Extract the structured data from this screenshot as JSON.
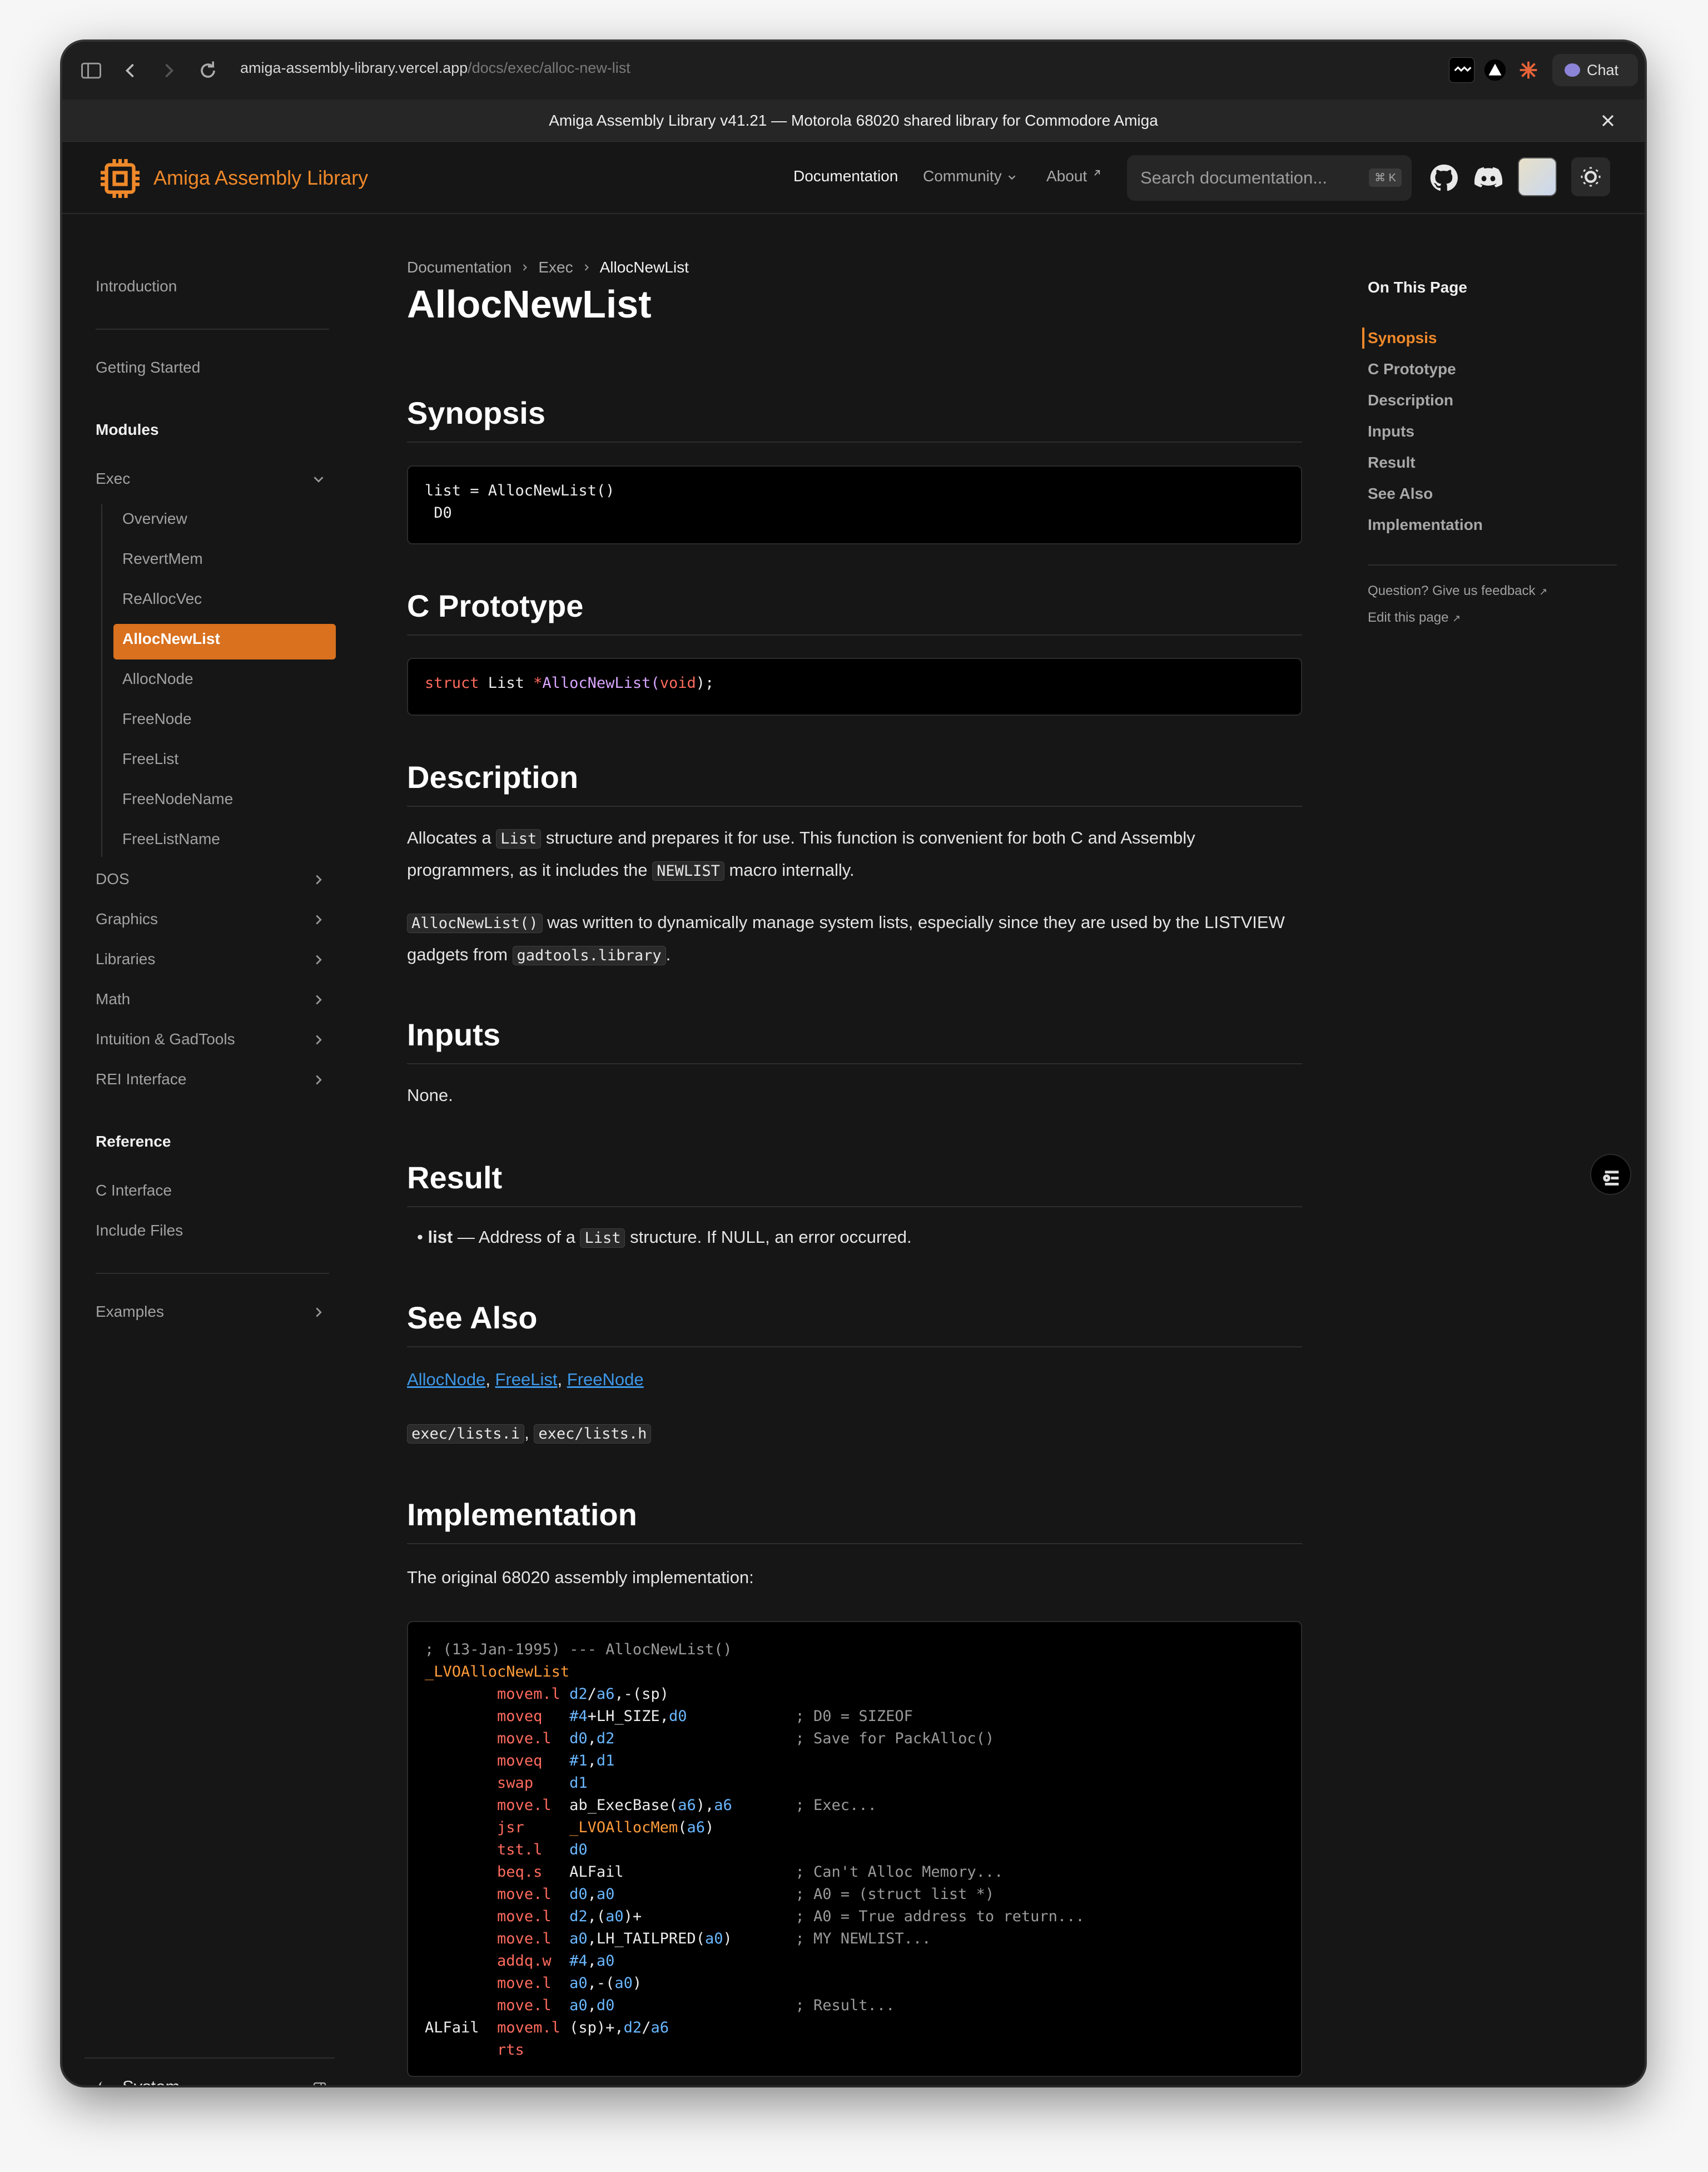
{
  "browser": {
    "url_host": "amiga-assembly-library.vercel.app",
    "url_path": "/docs/exec/alloc-new-list",
    "chat_label": "Chat"
  },
  "banner": {
    "text": "Amiga Assembly Library v41.21 — Motorola 68020 shared library for Commodore Amiga"
  },
  "header": {
    "brand": "Amiga Assembly Library",
    "nav_documentation": "Documentation",
    "nav_community": "Community",
    "nav_about": "About",
    "search_placeholder": "Search documentation...",
    "search_shortcut": "⌘ K"
  },
  "sidebar": {
    "introduction": "Introduction",
    "getting_started": "Getting Started",
    "modules_heading": "Modules",
    "exec": "Exec",
    "exec_items": [
      "Overview",
      "RevertMem",
      "ReAllocVec",
      "AllocNewList",
      "AllocNode",
      "FreeNode",
      "FreeList",
      "FreeNodeName",
      "FreeListName"
    ],
    "modules": [
      "DOS",
      "Graphics",
      "Libraries",
      "Math",
      "Intuition & GadTools",
      "REI Interface"
    ],
    "reference_heading": "Reference",
    "reference_items": [
      "C Interface",
      "Include Files"
    ],
    "examples": "Examples",
    "system_label": "System"
  },
  "breadcrumb": {
    "root": "Documentation",
    "section": "Exec",
    "current": "AllocNewList"
  },
  "page": {
    "title": "AllocNewList",
    "synopsis_heading": "Synopsis",
    "synopsis_code_line1": "list = AllocNewList()",
    "synopsis_code_line2": " D0",
    "prototype_heading": "C Prototype",
    "prototype": {
      "kw": "struct",
      "type": " List ",
      "star": "*",
      "fn": "AllocNewList",
      "paren_open": "(",
      "arg": "void",
      "paren_close": ");"
    },
    "description_heading": "Description",
    "desc1_a": "Allocates a ",
    "desc1_code1": "List",
    "desc1_b": " structure and prepares it for use. This function is convenient for both C and Assembly programmers, as it includes the ",
    "desc1_code2": "NEWLIST",
    "desc1_c": " macro internally.",
    "desc2_code1": "AllocNewList()",
    "desc2_a": " was written to dynamically manage system lists, especially since they are used by the LISTVIEW gadgets from ",
    "desc2_code2": "gadtools.library",
    "desc2_b": ".",
    "inputs_heading": "Inputs",
    "inputs_text": "None.",
    "result_heading": "Result",
    "result_term": "list",
    "result_a": " — Address of a ",
    "result_code": "List",
    "result_b": " structure. If NULL, an error occurred.",
    "seealso_heading": "See Also",
    "seealso_links": [
      "AllocNode",
      "FreeList",
      "FreeNode"
    ],
    "seealso_files": [
      "exec/lists.i",
      "exec/lists.h"
    ],
    "impl_heading": "Implementation",
    "impl_text": "The original 68020 assembly implementation:",
    "asm": [
      {
        "label": "",
        "op": "",
        "args": "",
        "comment": "; (13-Jan-1995) --- AllocNewList()"
      },
      {
        "label": "_LVOAllocNewList",
        "op": "",
        "args": "",
        "comment": ""
      },
      {
        "label": "",
        "op": "movem.l",
        "args": "d2/a6,-(sp)",
        "comment": ""
      },
      {
        "label": "",
        "op": "moveq",
        "args": "#4+LH_SIZE,d0",
        "comment": "; D0 = SIZEOF"
      },
      {
        "label": "",
        "op": "move.l",
        "args": "d0,d2",
        "comment": "; Save for PackAlloc()"
      },
      {
        "label": "",
        "op": "moveq",
        "args": "#1,d1",
        "comment": ""
      },
      {
        "label": "",
        "op": "swap",
        "args": "d1",
        "comment": ""
      },
      {
        "label": "",
        "op": "move.l",
        "args": "ab_ExecBase(a6),a6",
        "comment": "; Exec..."
      },
      {
        "label": "",
        "op": "jsr",
        "args": "_LVOAllocMem(a6)",
        "comment": ""
      },
      {
        "label": "",
        "op": "tst.l",
        "args": "d0",
        "comment": ""
      },
      {
        "label": "",
        "op": "beq.s",
        "args": "ALFail",
        "comment": "; Can't Alloc Memory..."
      },
      {
        "label": "",
        "op": "move.l",
        "args": "d0,a0",
        "comment": "; A0 = (struct list *)"
      },
      {
        "label": "",
        "op": "move.l",
        "args": "d2,(a0)+",
        "comment": "; A0 = True address to return..."
      },
      {
        "label": "",
        "op": "move.l",
        "args": "a0,LH_TAILPRED(a0)",
        "comment": "; MY NEWLIST..."
      },
      {
        "label": "",
        "op": "addq.w",
        "args": "#4,a0",
        "comment": ""
      },
      {
        "label": "",
        "op": "move.l",
        "args": "a0,-(a0)",
        "comment": ""
      },
      {
        "label": "",
        "op": "move.l",
        "args": "a0,d0",
        "comment": "; Result..."
      },
      {
        "label": "ALFail",
        "op": "movem.l",
        "args": "(sp)+,d2/a6",
        "comment": ""
      },
      {
        "label": "",
        "op": "rts",
        "args": "",
        "comment": ""
      }
    ]
  },
  "toc": {
    "title": "On This Page",
    "items": [
      "Synopsis",
      "C Prototype",
      "Description",
      "Inputs",
      "Result",
      "See Also",
      "Implementation"
    ],
    "feedback": "Question? Give us feedback",
    "edit": "Edit this page"
  },
  "colors": {
    "accent": "#f0892a",
    "active_item": "#d9711f",
    "link": "#3e98e8",
    "background": "#161616"
  }
}
